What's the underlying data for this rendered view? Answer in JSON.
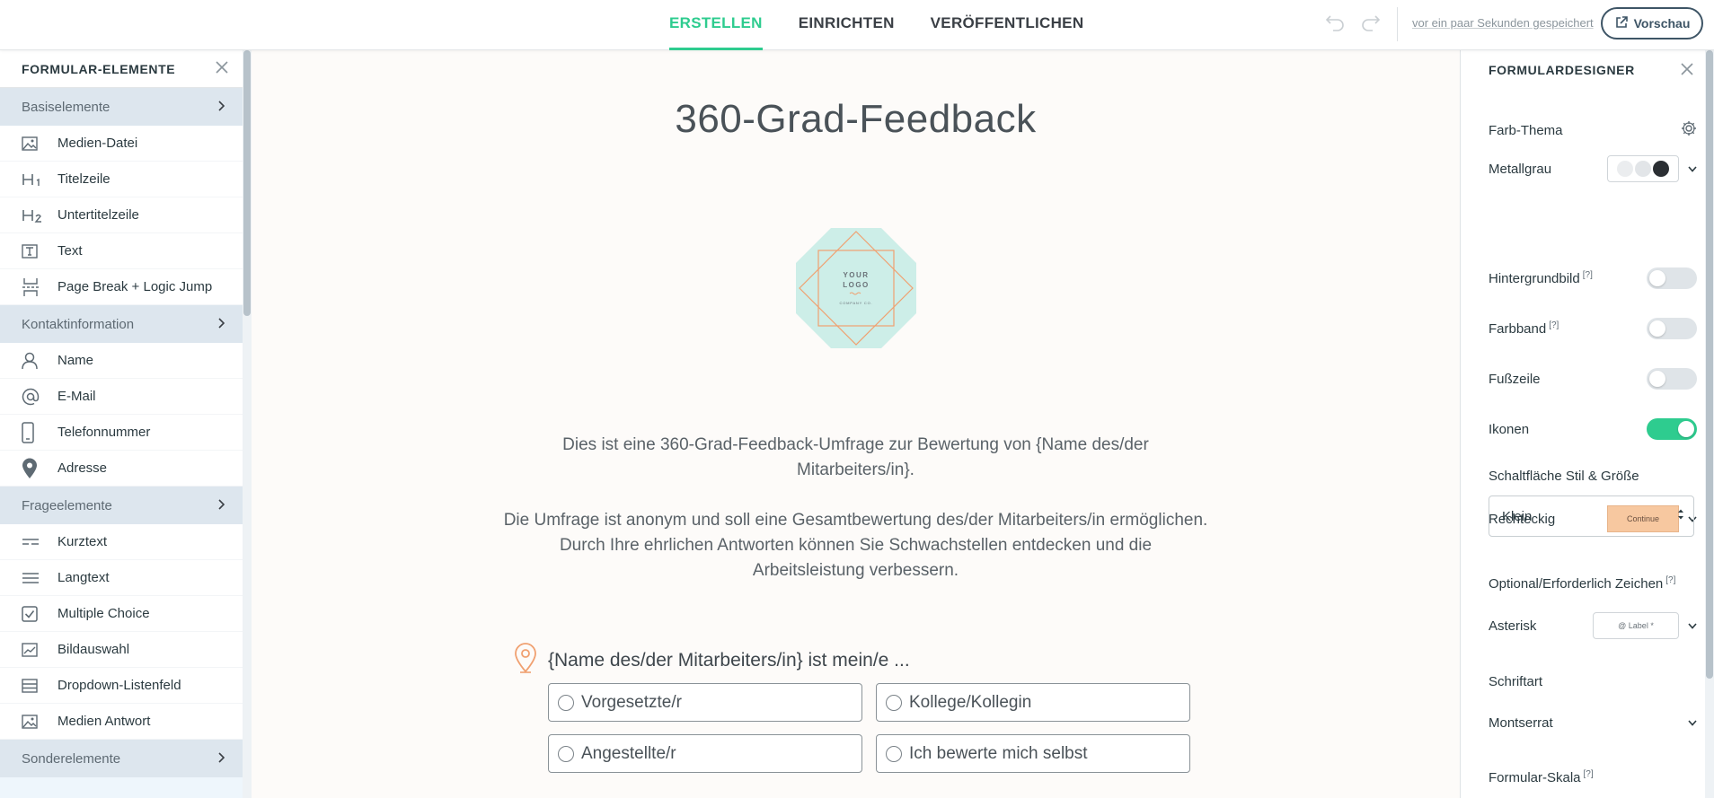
{
  "topbar": {
    "tabs": [
      {
        "label": "ERSTELLEN",
        "active": true
      },
      {
        "label": "EINRICHTEN",
        "active": false
      },
      {
        "label": "VERÖFFENTLICHEN",
        "active": false
      }
    ],
    "saved_text": "vor ein paar Sekunden gespeichert",
    "preview_label": "Vorschau",
    "icons": [
      "undo-icon",
      "redo-icon",
      "external-link-icon"
    ]
  },
  "left": {
    "title": "FORMULAR-ELEMENTE",
    "sections": [
      {
        "label": "Basiselemente",
        "items": [
          "Medien-Datei",
          "Titelzeile",
          "Untertitelzeile",
          "Text",
          "Page Break + Logic Jump"
        ]
      },
      {
        "label": "Kontaktinformation",
        "items": [
          "Name",
          "E-Mail",
          "Telefonnummer",
          "Adresse"
        ]
      },
      {
        "label": "Frageelemente",
        "items": [
          "Kurztext",
          "Langtext",
          "Multiple Choice",
          "Bildauswahl",
          "Dropdown-Listenfeld",
          "Medien Antwort"
        ]
      },
      {
        "label": "Sonderelemente",
        "items": []
      }
    ]
  },
  "canvas": {
    "title": "360-Grad-Feedback",
    "logo_text": {
      "line1": "YOUR",
      "line2": "LOGO",
      "sub": "COMPANY CO."
    },
    "description_1": "Dies ist eine 360-Grad-Feedback-Umfrage zur Bewertung von {Name des/der Mitarbeiters/in}.",
    "description_2": "Die Umfrage ist anonym und soll eine Gesamtbewertung des/der Mitarbeiters/in ermöglichen. Durch Ihre ehrlichen Antworten können Sie Schwachstellen entdecken und die Arbeitsleistung verbessern.",
    "question": {
      "label": "{Name des/der Mitarbeiters/in} ist mein/e ...",
      "options": [
        "Vorgesetzte/r",
        "Kollege/Kollegin",
        "Angestellte/r",
        "Ich bewerte mich selbst"
      ]
    }
  },
  "right": {
    "title": "FORMULARDESIGNER",
    "farb_thema": "Farb-Thema",
    "theme_name": "Metallgrau",
    "theme_colors": [
      "#ebedef",
      "#e2e5e8",
      "#2b2f33"
    ],
    "hintergrundbild": "Hintergrundbild",
    "farbband": "Farbband",
    "fusszeile": "Fußzeile",
    "ikonen": "Ikonen",
    "ikonen_on": true,
    "schaltflaeche": "Schaltfläche Stil & Größe",
    "button_shape": "Rechteckig",
    "button_preview": "Continue",
    "button_size": "Klein",
    "optional_zeichen": "Optional/Erforderlich Zeichen",
    "asterisk": "Asterisk",
    "label_preview": "@ Label *",
    "schriftart": "Schriftart",
    "font_value": "Montserrat",
    "formular_skala": "Formular-Skala",
    "help_mark": "[?]",
    "accent": "#2ecc8f"
  }
}
